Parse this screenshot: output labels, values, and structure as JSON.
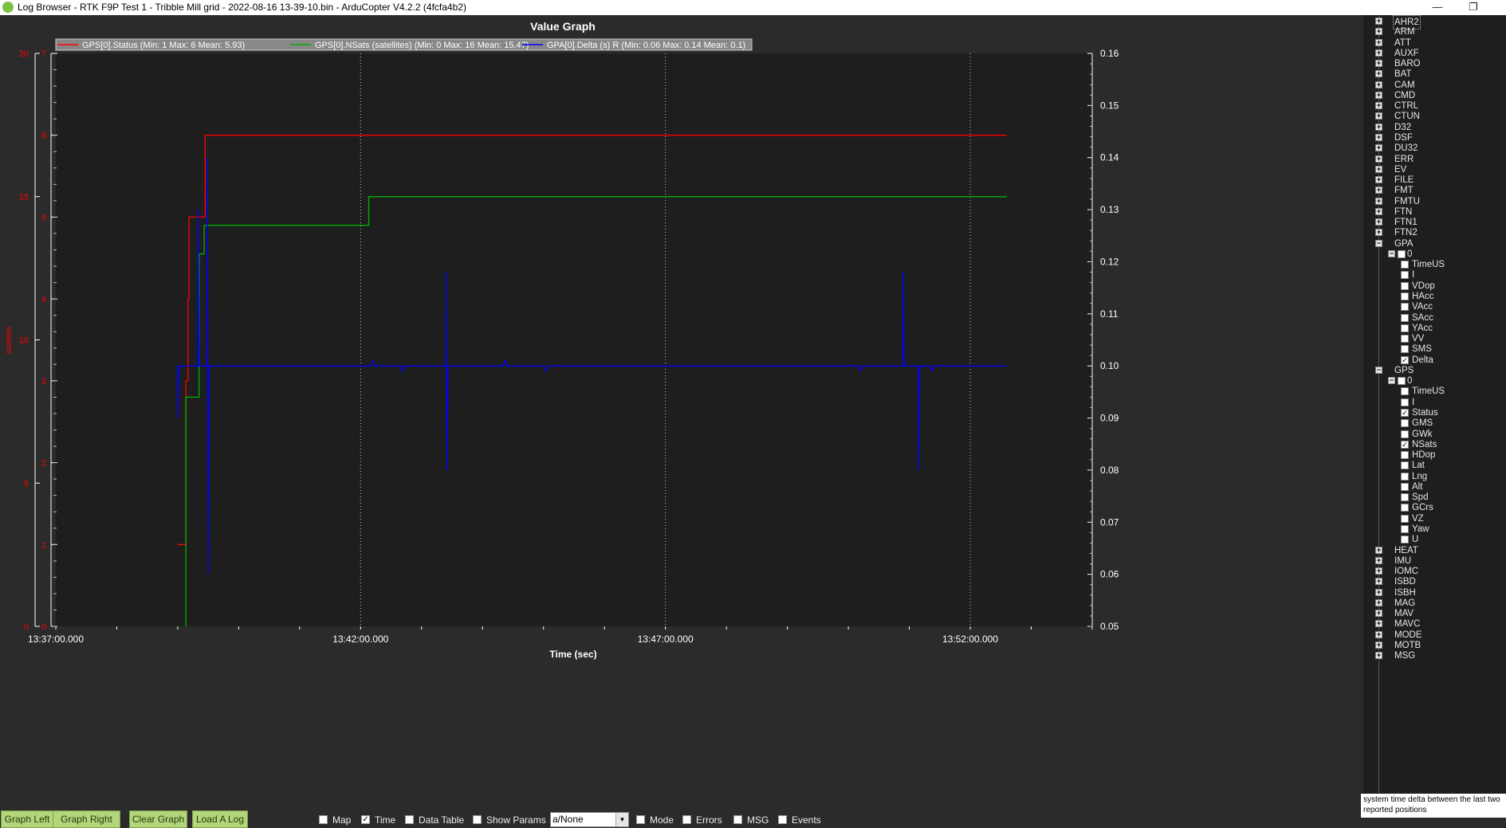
{
  "window": {
    "title": "Log Browser - RTK F9P Test 1 - Tribble Mill grid - 2022-08-16 13-39-10.bin - ArduCopter V4.2.2 (4fcfa4b2)",
    "minimize_glyph": "—",
    "restore_glyph": "❐"
  },
  "graph": {
    "title": "Value Graph",
    "xlabel": "Time (sec)",
    "left_axis_label": "satellites",
    "colors": {
      "status": "#ff0000",
      "nsats": "#00b000",
      "delta": "#0000ff",
      "plot_bg": "#1e1e1e",
      "grid": "#cfcfcf"
    }
  },
  "chart_data": {
    "type": "line",
    "title": "Value Graph",
    "xlabel": "Time (sec)",
    "ylabel": "satellites",
    "legend": "top-left",
    "grid": true,
    "x_ticks": [
      "13:37:00.000",
      "13:42:00.000",
      "13:47:00.000",
      "13:52:00.000"
    ],
    "y1_ticks": [
      "0",
      "1",
      "2",
      "3",
      "4",
      "5",
      "6",
      "7"
    ],
    "y2_ticks": [
      "0",
      "5",
      "10",
      "15",
      "20"
    ],
    "y3_ticks": [
      "0.05",
      "0.06",
      "0.07",
      "0.08",
      "0.09",
      "0.10",
      "0.11",
      "0.12",
      "0.13",
      "0.14",
      "0.15",
      "0.16"
    ],
    "series": [
      {
        "name": "GPS[0].Status",
        "legend": "GPS[0].Status  (Min: 1 Max: 6 Mean: 5.93)",
        "color": "#ff0000",
        "axis": "y1",
        "points": [
          [
            "13:39:00",
            1
          ],
          [
            "13:39:08",
            1
          ],
          [
            "13:39:08",
            3
          ],
          [
            "13:39:10",
            3
          ],
          [
            "13:39:10",
            4
          ],
          [
            "13:39:11",
            4
          ],
          [
            "13:39:11",
            5
          ],
          [
            "13:39:27",
            5
          ],
          [
            "13:39:27",
            6
          ],
          [
            "13:52:36",
            6
          ]
        ]
      },
      {
        "name": "GPS[0].NSats",
        "legend": "GPS[0].NSats (satellites)  (Min: 0 Max: 16 Mean: 15.47)",
        "color": "#00b000",
        "axis": "y2",
        "points": [
          [
            "13:39:08",
            0
          ],
          [
            "13:39:08",
            8
          ],
          [
            "13:39:21",
            8
          ],
          [
            "13:39:21",
            13
          ],
          [
            "13:39:26",
            13
          ],
          [
            "13:39:26",
            14
          ],
          [
            "13:42:08",
            14
          ],
          [
            "13:42:08",
            15
          ],
          [
            "13:52:36",
            15
          ]
        ]
      },
      {
        "name": "GPA[0].Delta",
        "legend": "GPA[0].Delta (s)  R (Min: 0.06 Max: 0.14 Mean: 0.1)",
        "color": "#0000ff",
        "axis": "y3",
        "points": [
          [
            "13:39:00",
            0.1
          ],
          [
            "13:39:00",
            0.09
          ],
          [
            "13:39:01",
            0.1
          ],
          [
            "13:39:20",
            0.1
          ],
          [
            "13:39:20",
            0.13
          ],
          [
            "13:39:21",
            0.1
          ],
          [
            "13:39:29",
            0.1
          ],
          [
            "13:39:29",
            0.14
          ],
          [
            "13:39:30",
            0.06
          ],
          [
            "13:39:31",
            0.1
          ],
          [
            "13:40:05",
            0.1
          ],
          [
            "13:42:10",
            0.1
          ],
          [
            "13:42:12",
            0.101
          ],
          [
            "13:42:14",
            0.1
          ],
          [
            "13:42:40",
            0.1
          ],
          [
            "13:42:41",
            0.099
          ],
          [
            "13:42:43",
            0.1
          ],
          [
            "13:43:24",
            0.1
          ],
          [
            "13:43:24",
            0.118
          ],
          [
            "13:43:25",
            0.08
          ],
          [
            "13:43:26",
            0.1
          ],
          [
            "13:44:20",
            0.1
          ],
          [
            "13:44:22",
            0.101
          ],
          [
            "13:44:24",
            0.1
          ],
          [
            "13:45:00",
            0.1
          ],
          [
            "13:45:02",
            0.099
          ],
          [
            "13:45:04",
            0.1
          ],
          [
            "13:50:10",
            0.1
          ],
          [
            "13:50:12",
            0.099
          ],
          [
            "13:50:14",
            0.1
          ],
          [
            "13:50:54",
            0.1
          ],
          [
            "13:50:54",
            0.118
          ],
          [
            "13:50:55",
            0.1
          ],
          [
            "13:51:09",
            0.1
          ],
          [
            "13:51:09",
            0.08
          ],
          [
            "13:51:10",
            0.1
          ],
          [
            "13:51:20",
            0.1
          ],
          [
            "13:51:22",
            0.099
          ],
          [
            "13:51:24",
            0.1
          ],
          [
            "13:52:36",
            0.1
          ]
        ]
      }
    ]
  },
  "tree": {
    "items": [
      {
        "label": "AHR2",
        "type": "group",
        "expander": "+",
        "selected": true
      },
      {
        "label": "ARM",
        "type": "group",
        "expander": "+"
      },
      {
        "label": "ATT",
        "type": "group",
        "expander": "+"
      },
      {
        "label": "AUXF",
        "type": "group",
        "expander": "+"
      },
      {
        "label": "BARO",
        "type": "group",
        "expander": "+"
      },
      {
        "label": "BAT",
        "type": "group",
        "expander": "+"
      },
      {
        "label": "CAM",
        "type": "group",
        "expander": "+"
      },
      {
        "label": "CMD",
        "type": "group",
        "expander": "+"
      },
      {
        "label": "CTRL",
        "type": "group",
        "expander": "+"
      },
      {
        "label": "CTUN",
        "type": "group",
        "expander": "+"
      },
      {
        "label": "D32",
        "type": "group",
        "expander": "+"
      },
      {
        "label": "DSF",
        "type": "group",
        "expander": "+"
      },
      {
        "label": "DU32",
        "type": "group",
        "expander": "+"
      },
      {
        "label": "ERR",
        "type": "group",
        "expander": "+"
      },
      {
        "label": "EV",
        "type": "group",
        "expander": "+"
      },
      {
        "label": "FILE",
        "type": "group",
        "expander": "+"
      },
      {
        "label": "FMT",
        "type": "group",
        "expander": "+"
      },
      {
        "label": "FMTU",
        "type": "group",
        "expander": "+"
      },
      {
        "label": "FTN",
        "type": "group",
        "expander": "+"
      },
      {
        "label": "FTN1",
        "type": "group",
        "expander": "+"
      },
      {
        "label": "FTN2",
        "type": "group",
        "expander": "+"
      },
      {
        "label": "GPA",
        "type": "group",
        "expander": "−"
      },
      {
        "label": "0",
        "type": "instance",
        "expander": "−"
      },
      {
        "label": "TimeUS",
        "type": "field",
        "checked": false
      },
      {
        "label": "I",
        "type": "field",
        "checked": false
      },
      {
        "label": "VDop",
        "type": "field",
        "checked": false
      },
      {
        "label": "HAcc",
        "type": "field",
        "checked": false
      },
      {
        "label": "VAcc",
        "type": "field",
        "checked": false
      },
      {
        "label": "SAcc",
        "type": "field",
        "checked": false
      },
      {
        "label": "YAcc",
        "type": "field",
        "checked": false
      },
      {
        "label": "VV",
        "type": "field",
        "checked": false
      },
      {
        "label": "SMS",
        "type": "field",
        "checked": false
      },
      {
        "label": "Delta",
        "type": "field",
        "checked": true
      },
      {
        "label": "GPS",
        "type": "group",
        "expander": "−"
      },
      {
        "label": "0",
        "type": "instance",
        "expander": "−"
      },
      {
        "label": "TimeUS",
        "type": "field",
        "checked": false
      },
      {
        "label": "I",
        "type": "field",
        "checked": false
      },
      {
        "label": "Status",
        "type": "field",
        "checked": true
      },
      {
        "label": "GMS",
        "type": "field",
        "checked": false
      },
      {
        "label": "GWk",
        "type": "field",
        "checked": false
      },
      {
        "label": "NSats",
        "type": "field",
        "checked": true
      },
      {
        "label": "HDop",
        "type": "field",
        "checked": false
      },
      {
        "label": "Lat",
        "type": "field",
        "checked": false
      },
      {
        "label": "Lng",
        "type": "field",
        "checked": false
      },
      {
        "label": "Alt",
        "type": "field",
        "checked": false
      },
      {
        "label": "Spd",
        "type": "field",
        "checked": false
      },
      {
        "label": "GCrs",
        "type": "field",
        "checked": false
      },
      {
        "label": "VZ",
        "type": "field",
        "checked": false
      },
      {
        "label": "Yaw",
        "type": "field",
        "checked": false
      },
      {
        "label": "U",
        "type": "field",
        "checked": false
      },
      {
        "label": "HEAT",
        "type": "group",
        "expander": "+"
      },
      {
        "label": "IMU",
        "type": "group",
        "expander": "+"
      },
      {
        "label": "IOMC",
        "type": "group",
        "expander": "+"
      },
      {
        "label": "ISBD",
        "type": "group",
        "expander": "+"
      },
      {
        "label": "ISBH",
        "type": "group",
        "expander": "+"
      },
      {
        "label": "MAG",
        "type": "group",
        "expander": "+"
      },
      {
        "label": "MAV",
        "type": "group",
        "expander": "+"
      },
      {
        "label": "MAVC",
        "type": "group",
        "expander": "+"
      },
      {
        "label": "MODE",
        "type": "group",
        "expander": "+"
      },
      {
        "label": "MOTB",
        "type": "group",
        "expander": "+"
      },
      {
        "label": "MSG",
        "type": "group",
        "expander": "+"
      }
    ],
    "description": "system time delta between the last two reported positions"
  },
  "toolbar": {
    "buttons": [
      {
        "name": "graph-left-button",
        "label": "Graph Left"
      },
      {
        "name": "graph-right-button",
        "label": "Graph Right"
      },
      {
        "name": "clear-graph-button",
        "label": "Clear Graph"
      },
      {
        "name": "load-a-log-button",
        "label": "Load A Log"
      }
    ],
    "checkboxes_left": [
      {
        "name": "map-checkbox",
        "label": "Map",
        "checked": false
      },
      {
        "name": "time-checkbox",
        "label": "Time",
        "checked": true
      },
      {
        "name": "data-table-checkbox",
        "label": "Data Table",
        "checked": false
      },
      {
        "name": "show-params-checkbox",
        "label": "Show Params",
        "checked": false
      }
    ],
    "combo_value": "a/None",
    "checkboxes_right": [
      {
        "name": "mode-checkbox",
        "label": "Mode",
        "checked": false
      },
      {
        "name": "errors-checkbox",
        "label": "Errors",
        "checked": false
      },
      {
        "name": "msg-checkbox",
        "label": "MSG",
        "checked": false
      },
      {
        "name": "events-checkbox",
        "label": "Events",
        "checked": false
      }
    ]
  }
}
